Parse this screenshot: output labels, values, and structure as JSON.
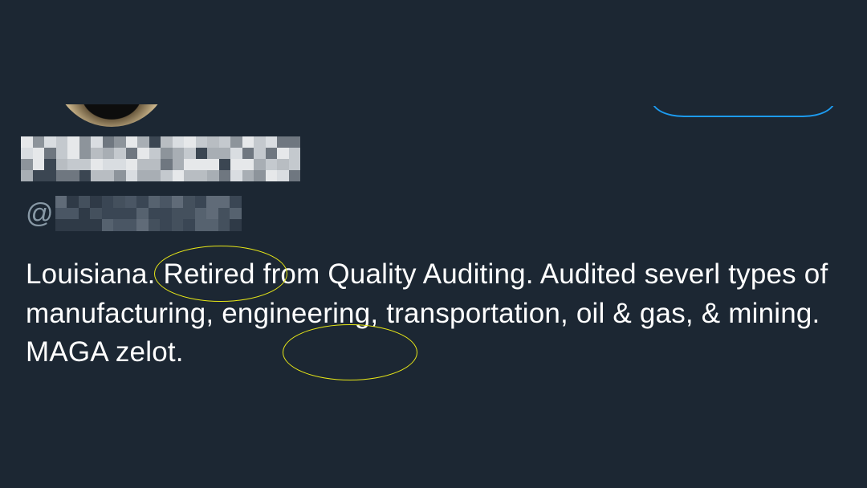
{
  "profile": {
    "display_name_blurred": true,
    "handle_prefix": "@",
    "handle_blurred": true,
    "bio": "Louisiana. Retired from Quality Auditing. Audited severl types of manufacturing, engineering, transportation, oil & gas, & mining. MAGA zelot."
  },
  "colors": {
    "background": "#1c2733",
    "text": "#ffffff",
    "secondary_text": "#8899a6",
    "accent": "#1d9bf0",
    "annotation": "#e8e817"
  },
  "icons": {
    "avatar": "profile-avatar",
    "follow_button": "follow-button-outline"
  }
}
